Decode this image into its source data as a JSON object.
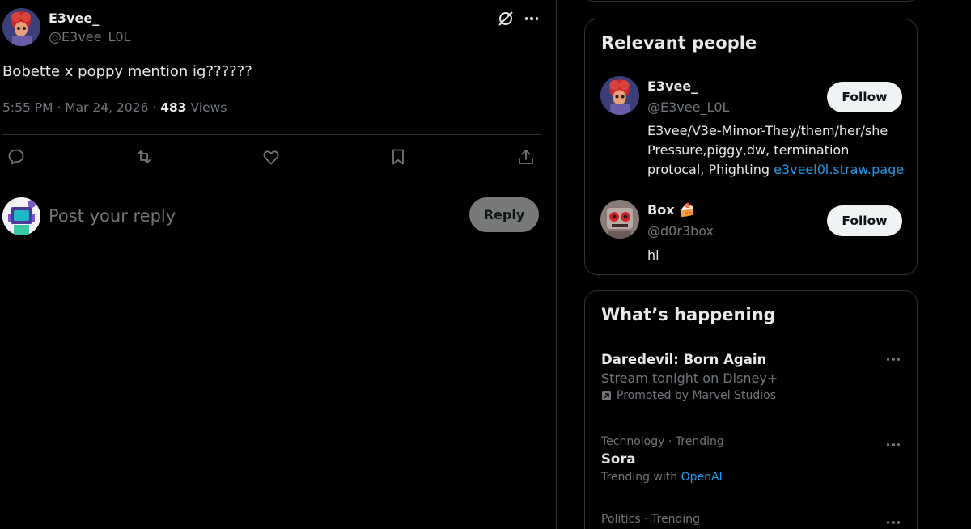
{
  "post": {
    "author_name": "E3vee_",
    "author_handle": "@E3vee_L0L",
    "text": "Bobette x poppy mention ig??????",
    "time": "5:55 PM · Mar 24, 2026 · ",
    "views_count": "483",
    "views_label": " Views",
    "actions": [
      "reply-icon",
      "repost-icon",
      "like-icon",
      "bookmark-icon",
      "share-icon"
    ]
  },
  "reply": {
    "placeholder": "Post your reply",
    "button_label": "Reply"
  },
  "relevant_people": {
    "title": "Relevant people",
    "people": [
      {
        "name": "E3vee_",
        "handle": "@E3vee_L0L",
        "bio": "E3vee/V3e-Mimor-They/them/her/she Pressure,piggy,dw, termination protocal, Phighting ",
        "bio_link": "e3veel0l.straw.page",
        "follow_label": "Follow"
      },
      {
        "name": "Box 🍰",
        "handle": "@d0r3box",
        "bio": "hi",
        "follow_label": "Follow"
      }
    ]
  },
  "whats_happening": {
    "title": "What’s happening",
    "trends": [
      {
        "title": "Daredevil: Born Again",
        "subtitle": "Stream tonight on Disney+",
        "promoted": "Promoted by Marvel Studios"
      },
      {
        "context": "Technology · Trending",
        "title": "Sora",
        "trending_with_label": "Trending with ",
        "trending_with_link": "OpenAI"
      },
      {
        "context": "Politics · Trending"
      }
    ]
  },
  "colors": {
    "background": "#000000",
    "text": "#e7e9ea",
    "muted": "#71767b",
    "border": "#2f3336",
    "link": "#1d9bf0"
  }
}
